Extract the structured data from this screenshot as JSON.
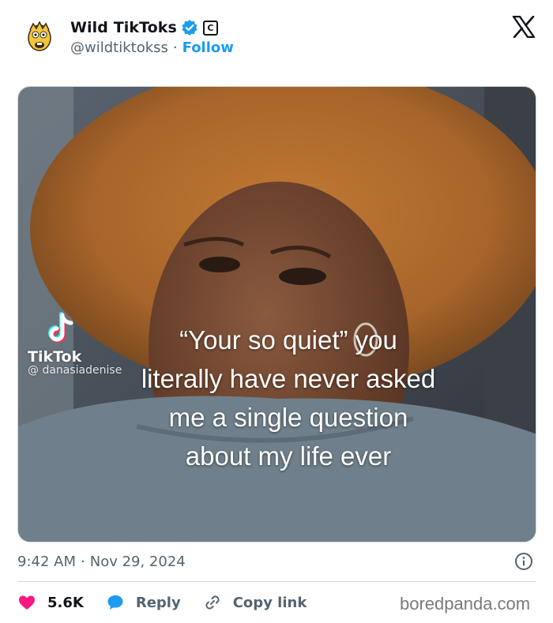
{
  "author": {
    "display_name": "Wild TikToks",
    "handle": "@wildtiktokss",
    "separator": "·",
    "follow_label": "Follow",
    "badge_letter": "C",
    "verified_color": "#1d9bf0"
  },
  "video": {
    "watermark_brand": "TikTok",
    "watermark_user": "@ danasiadenise",
    "caption_lines": [
      "“Your so quiet” you",
      "literally have never asked",
      "me a single question",
      "about my life ever"
    ]
  },
  "meta": {
    "time": "9:42 AM",
    "separator": "·",
    "date": "Nov 29, 2024"
  },
  "actions": {
    "likes": "5.6K",
    "reply_label": "Reply",
    "copy_label": "Copy link",
    "like_color": "#f91880",
    "reply_color": "#1d9bf0"
  },
  "source_brand": "boredpanda.com",
  "icons": [
    "cartoon-avatar-icon",
    "verified-badge-icon",
    "affiliate-badge-icon",
    "x-logo-icon",
    "tiktok-logo-icon",
    "info-icon",
    "heart-icon",
    "reply-bubble-icon",
    "link-icon"
  ]
}
